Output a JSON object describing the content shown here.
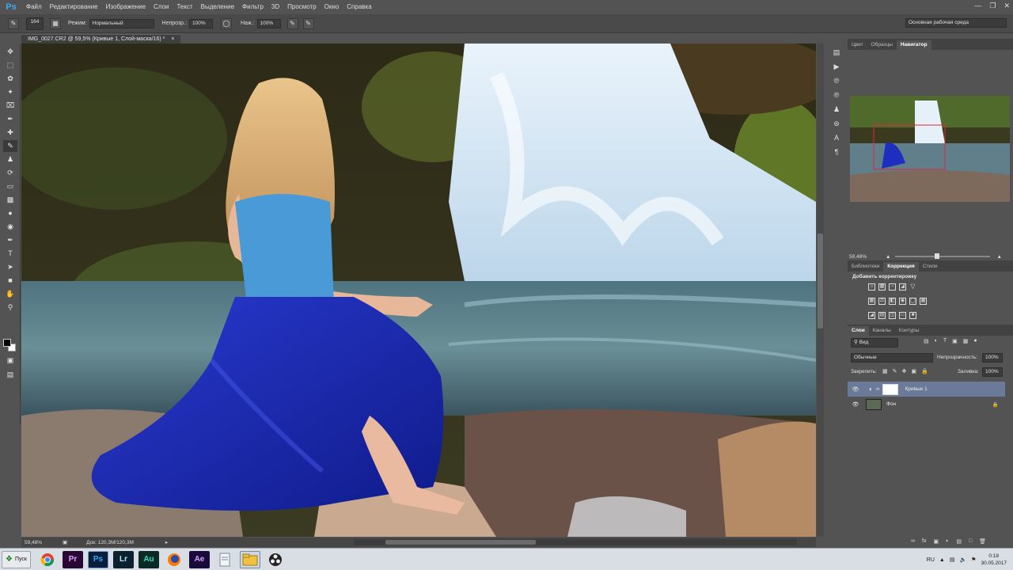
{
  "app": {
    "logo": "Ps"
  },
  "menu": [
    "Файл",
    "Редактирование",
    "Изображение",
    "Слои",
    "Текст",
    "Выделение",
    "Фильтр",
    "3D",
    "Просмотр",
    "Окно",
    "Справка"
  ],
  "options": {
    "brush_size": "164",
    "mode_label": "Режим:",
    "mode_value": "Нормальный",
    "opacity_label": "Непрозр.:",
    "opacity_value": "100%",
    "pressure_label": "Наж.:",
    "pressure_value": "100%",
    "workspace": "Основная рабочая среда"
  },
  "document": {
    "tab_title": "IMG_0027.CR2 @ 59,5% (Кривые 1, Слой-маска/16) *",
    "zoom": "59,48%",
    "doc_size": "Док: 120,3M/120,3M"
  },
  "panels": {
    "top_tabs": [
      "Цвет",
      "Образцы",
      "Навигатор"
    ],
    "navigator_zoom": "59,48%",
    "mid_tabs": [
      "Библиотеки",
      "Коррекция",
      "Стили"
    ],
    "add_adjustment": "Добавить корректировку",
    "layer_tabs": [
      "Слои",
      "Каналы",
      "Контуры"
    ]
  },
  "layers": {
    "filter": "Вид",
    "blend_mode": "Обычные",
    "opacity_label": "Непрозрачность:",
    "opacity_value": "100%",
    "lock_label": "Закрепить:",
    "fill_label": "Заливка:",
    "fill_value": "100%",
    "items": [
      {
        "name": "Кривые 1",
        "selected": true
      },
      {
        "name": "Фон",
        "selected": false
      }
    ]
  },
  "taskbar": {
    "start": "Пуск",
    "apps": [
      "chrome-icon",
      "premiere-icon",
      "photoshop-icon",
      "lightroom-icon",
      "audition-icon",
      "firefox-icon",
      "after-effects-icon",
      "document-icon",
      "explorer-icon",
      "obs-icon"
    ],
    "app_labels": [
      "",
      "Pr",
      "Ps",
      "Lr",
      "Au",
      "",
      "Ae",
      "",
      "",
      ""
    ],
    "lang": "RU",
    "time": "0:18",
    "date": "30.05.2017"
  }
}
